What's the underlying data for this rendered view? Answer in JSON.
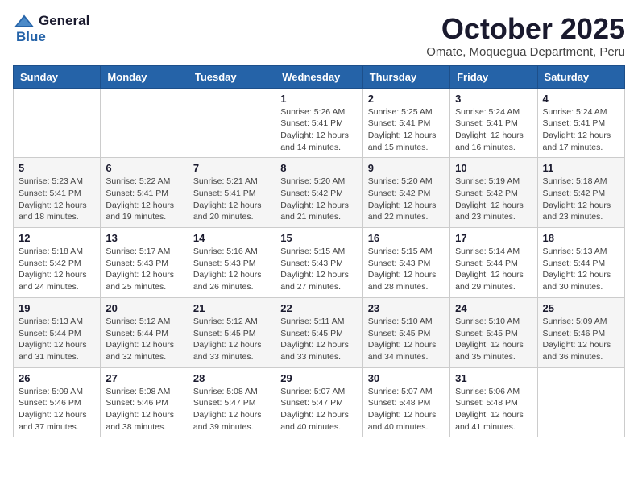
{
  "logo": {
    "line1": "General",
    "line2": "Blue"
  },
  "title": "October 2025",
  "subtitle": "Omate, Moquegua Department, Peru",
  "weekdays": [
    "Sunday",
    "Monday",
    "Tuesday",
    "Wednesday",
    "Thursday",
    "Friday",
    "Saturday"
  ],
  "weeks": [
    [
      {
        "day": "",
        "info": ""
      },
      {
        "day": "",
        "info": ""
      },
      {
        "day": "",
        "info": ""
      },
      {
        "day": "1",
        "info": "Sunrise: 5:26 AM\nSunset: 5:41 PM\nDaylight: 12 hours\nand 14 minutes."
      },
      {
        "day": "2",
        "info": "Sunrise: 5:25 AM\nSunset: 5:41 PM\nDaylight: 12 hours\nand 15 minutes."
      },
      {
        "day": "3",
        "info": "Sunrise: 5:24 AM\nSunset: 5:41 PM\nDaylight: 12 hours\nand 16 minutes."
      },
      {
        "day": "4",
        "info": "Sunrise: 5:24 AM\nSunset: 5:41 PM\nDaylight: 12 hours\nand 17 minutes."
      }
    ],
    [
      {
        "day": "5",
        "info": "Sunrise: 5:23 AM\nSunset: 5:41 PM\nDaylight: 12 hours\nand 18 minutes."
      },
      {
        "day": "6",
        "info": "Sunrise: 5:22 AM\nSunset: 5:41 PM\nDaylight: 12 hours\nand 19 minutes."
      },
      {
        "day": "7",
        "info": "Sunrise: 5:21 AM\nSunset: 5:41 PM\nDaylight: 12 hours\nand 20 minutes."
      },
      {
        "day": "8",
        "info": "Sunrise: 5:20 AM\nSunset: 5:42 PM\nDaylight: 12 hours\nand 21 minutes."
      },
      {
        "day": "9",
        "info": "Sunrise: 5:20 AM\nSunset: 5:42 PM\nDaylight: 12 hours\nand 22 minutes."
      },
      {
        "day": "10",
        "info": "Sunrise: 5:19 AM\nSunset: 5:42 PM\nDaylight: 12 hours\nand 23 minutes."
      },
      {
        "day": "11",
        "info": "Sunrise: 5:18 AM\nSunset: 5:42 PM\nDaylight: 12 hours\nand 23 minutes."
      }
    ],
    [
      {
        "day": "12",
        "info": "Sunrise: 5:18 AM\nSunset: 5:42 PM\nDaylight: 12 hours\nand 24 minutes."
      },
      {
        "day": "13",
        "info": "Sunrise: 5:17 AM\nSunset: 5:43 PM\nDaylight: 12 hours\nand 25 minutes."
      },
      {
        "day": "14",
        "info": "Sunrise: 5:16 AM\nSunset: 5:43 PM\nDaylight: 12 hours\nand 26 minutes."
      },
      {
        "day": "15",
        "info": "Sunrise: 5:15 AM\nSunset: 5:43 PM\nDaylight: 12 hours\nand 27 minutes."
      },
      {
        "day": "16",
        "info": "Sunrise: 5:15 AM\nSunset: 5:43 PM\nDaylight: 12 hours\nand 28 minutes."
      },
      {
        "day": "17",
        "info": "Sunrise: 5:14 AM\nSunset: 5:44 PM\nDaylight: 12 hours\nand 29 minutes."
      },
      {
        "day": "18",
        "info": "Sunrise: 5:13 AM\nSunset: 5:44 PM\nDaylight: 12 hours\nand 30 minutes."
      }
    ],
    [
      {
        "day": "19",
        "info": "Sunrise: 5:13 AM\nSunset: 5:44 PM\nDaylight: 12 hours\nand 31 minutes."
      },
      {
        "day": "20",
        "info": "Sunrise: 5:12 AM\nSunset: 5:44 PM\nDaylight: 12 hours\nand 32 minutes."
      },
      {
        "day": "21",
        "info": "Sunrise: 5:12 AM\nSunset: 5:45 PM\nDaylight: 12 hours\nand 33 minutes."
      },
      {
        "day": "22",
        "info": "Sunrise: 5:11 AM\nSunset: 5:45 PM\nDaylight: 12 hours\nand 33 minutes."
      },
      {
        "day": "23",
        "info": "Sunrise: 5:10 AM\nSunset: 5:45 PM\nDaylight: 12 hours\nand 34 minutes."
      },
      {
        "day": "24",
        "info": "Sunrise: 5:10 AM\nSunset: 5:45 PM\nDaylight: 12 hours\nand 35 minutes."
      },
      {
        "day": "25",
        "info": "Sunrise: 5:09 AM\nSunset: 5:46 PM\nDaylight: 12 hours\nand 36 minutes."
      }
    ],
    [
      {
        "day": "26",
        "info": "Sunrise: 5:09 AM\nSunset: 5:46 PM\nDaylight: 12 hours\nand 37 minutes."
      },
      {
        "day": "27",
        "info": "Sunrise: 5:08 AM\nSunset: 5:46 PM\nDaylight: 12 hours\nand 38 minutes."
      },
      {
        "day": "28",
        "info": "Sunrise: 5:08 AM\nSunset: 5:47 PM\nDaylight: 12 hours\nand 39 minutes."
      },
      {
        "day": "29",
        "info": "Sunrise: 5:07 AM\nSunset: 5:47 PM\nDaylight: 12 hours\nand 40 minutes."
      },
      {
        "day": "30",
        "info": "Sunrise: 5:07 AM\nSunset: 5:48 PM\nDaylight: 12 hours\nand 40 minutes."
      },
      {
        "day": "31",
        "info": "Sunrise: 5:06 AM\nSunset: 5:48 PM\nDaylight: 12 hours\nand 41 minutes."
      },
      {
        "day": "",
        "info": ""
      }
    ]
  ]
}
